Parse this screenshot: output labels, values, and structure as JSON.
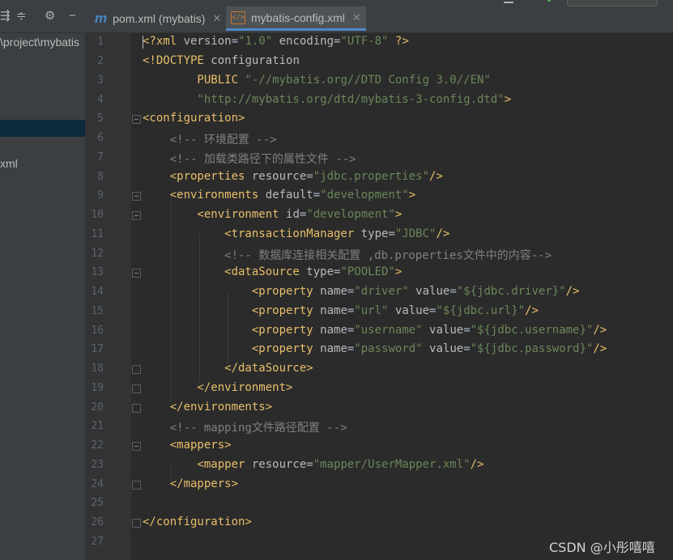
{
  "tabs": [
    {
      "label": "pom.xml (mybatis)",
      "icon": "maven-m-icon",
      "active": false
    },
    {
      "label": "mybatis-config.xml",
      "icon": "xml-file-icon",
      "active": true
    }
  ],
  "project": {
    "path": "\\project\\mybatis",
    "file_label": "xml"
  },
  "editor": {
    "line_numbers": [
      "1",
      "2",
      "3",
      "4",
      "5",
      "6",
      "7",
      "8",
      "9",
      "10",
      "11",
      "12",
      "13",
      "14",
      "15",
      "16",
      "17",
      "18",
      "19",
      "20",
      "21",
      "22",
      "23",
      "24",
      "25",
      "26",
      "27"
    ]
  },
  "watermark": "CSDN @小彤嘻嘻",
  "colors": {
    "background": "#2b2b2b",
    "tag": "#e8bf6a",
    "attribute": "#bababa",
    "value": "#6a8759",
    "comment": "#808080",
    "accent": "#4a88c7"
  }
}
